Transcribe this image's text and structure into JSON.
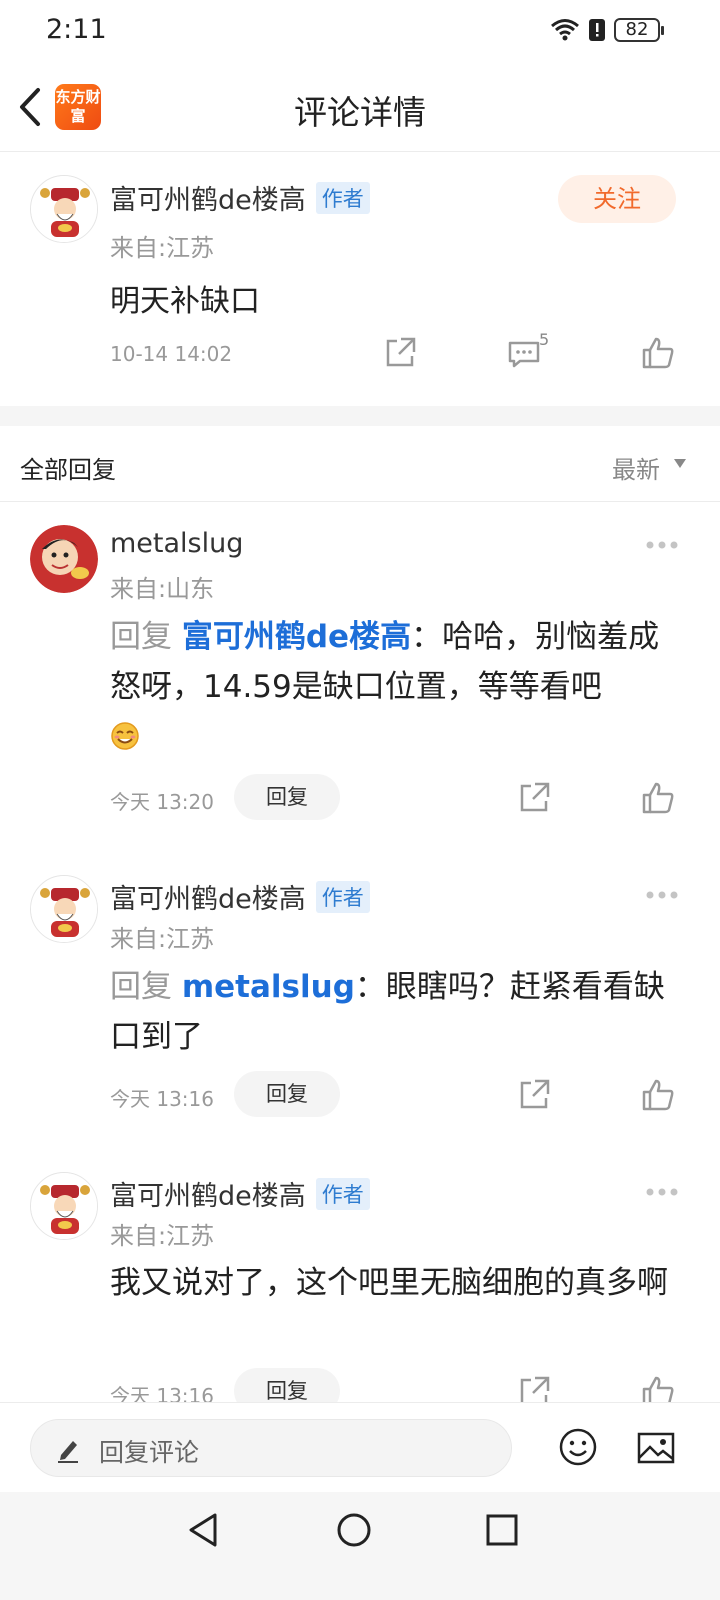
{
  "status_bar": {
    "time": "2:11",
    "battery": "82"
  },
  "header": {
    "title": "评论详情",
    "logo_text": "东方财富"
  },
  "main_comment": {
    "author": "富可州鹤de楼高",
    "author_tag": "作者",
    "location": "来自:江苏",
    "follow_label": "关注",
    "content": "明天补缺口",
    "time": "10-14 14:02",
    "reply_count": "5"
  },
  "replies_header": {
    "label": "全部回复",
    "sort": "最新"
  },
  "replies": [
    {
      "author": "metalslug",
      "location": "来自:山东",
      "prefix": "回复",
      "target": "富可州鹤de楼高",
      "text": "：哈哈，别恼羞成怒呀，14.59是缺口位置，等等看吧",
      "time": "今天 13:20",
      "reply_label": "回复"
    },
    {
      "author": "富可州鹤de楼高",
      "author_tag": "作者",
      "location": "来自:江苏",
      "prefix": "回复",
      "target": "metalslug",
      "text": "：眼瞎吗？赶紧看看缺口到了",
      "time": "今天 13:16",
      "reply_label": "回复"
    },
    {
      "author": "富可州鹤de楼高",
      "author_tag": "作者",
      "location": "来自:江苏",
      "text": "我又说对了，这个吧里无脑细胞的真多啊",
      "time": "今天 13:16",
      "reply_label": "回复"
    }
  ],
  "bottom_bar": {
    "input_placeholder": "回复评论"
  },
  "icons": {
    "back": "chevron-left-icon",
    "share": "share-icon",
    "comment": "comment-icon",
    "like": "thumbs-up-icon",
    "more": "more-dots-icon",
    "edit": "pencil-icon",
    "emoji": "smiley-icon",
    "image": "image-icon"
  }
}
